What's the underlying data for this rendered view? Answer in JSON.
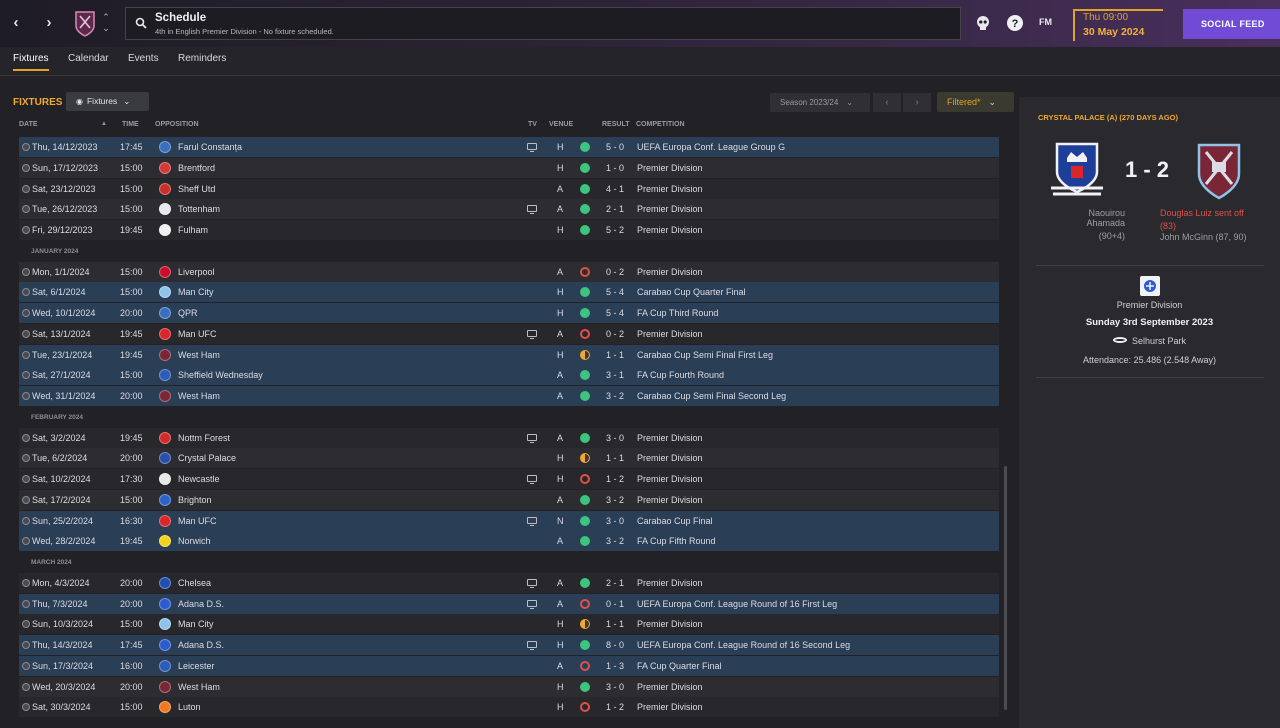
{
  "topbar": {
    "title": "Schedule",
    "subtitle": "4th in English Premier Division - No fixture scheduled.",
    "fm_label": "FM",
    "date_time": "Thu 09:00",
    "date_day": "30 May 2024",
    "social_feed_label": "SOCIAL FEED"
  },
  "tabs": [
    {
      "label": "Fixtures",
      "active": true
    },
    {
      "label": "Calendar",
      "active": false
    },
    {
      "label": "Events",
      "active": false
    },
    {
      "label": "Reminders",
      "active": false
    }
  ],
  "fixtures": {
    "title": "FIXTURES",
    "view_dropdown": "Fixtures",
    "season_dropdown": "Season 2023/24",
    "filter_label": "Filtered*",
    "columns": {
      "date": "DATE",
      "time": "TIME",
      "opposition": "OPPOSITION",
      "tv": "TV",
      "venue": "VENUE",
      "result": "RESULT",
      "competition": "COMPETITION"
    },
    "months": [
      "JANUARY 2024",
      "FEBRUARY 2024",
      "MARCH 2024"
    ],
    "rows": [
      {
        "date": "Thu, 14/12/2023",
        "time": "17:45",
        "opp": "Farul Constanța",
        "tv": true,
        "venue": "H",
        "outcome": "W",
        "result": "5 - 0",
        "comp": "UEFA Europa Conf. League Group G",
        "hl": true,
        "badge": "#3a6fc0"
      },
      {
        "date": "Sun, 17/12/2023",
        "time": "15:00",
        "opp": "Brentford",
        "tv": false,
        "venue": "H",
        "outcome": "W",
        "result": "1 - 0",
        "comp": "Premier Division",
        "hl": false,
        "badge": "#d23a3a"
      },
      {
        "date": "Sat, 23/12/2023",
        "time": "15:00",
        "opp": "Sheff Utd",
        "tv": false,
        "venue": "A",
        "outcome": "W",
        "result": "4 - 1",
        "comp": "Premier Division",
        "hl": false,
        "badge": "#c8302c"
      },
      {
        "date": "Tue, 26/12/2023",
        "time": "15:00",
        "opp": "Tottenham",
        "tv": true,
        "venue": "A",
        "outcome": "W",
        "result": "2 - 1",
        "comp": "Premier Division",
        "hl": false,
        "badge": "#e8e8f0"
      },
      {
        "date": "Fri, 29/12/2023",
        "time": "19:45",
        "opp": "Fulham",
        "tv": false,
        "venue": "H",
        "outcome": "W",
        "result": "5 - 2",
        "comp": "Premier Division",
        "hl": false,
        "badge": "#f0f0f0"
      },
      {
        "month": 0
      },
      {
        "date": "Mon, 1/1/2024",
        "time": "15:00",
        "opp": "Liverpool",
        "tv": false,
        "venue": "A",
        "outcome": "L",
        "result": "0 - 2",
        "comp": "Premier Division",
        "hl": false,
        "badge": "#c8102e"
      },
      {
        "date": "Sat, 6/1/2024",
        "time": "15:00",
        "opp": "Man City",
        "tv": false,
        "venue": "H",
        "outcome": "W",
        "result": "5 - 4",
        "comp": "Carabao Cup Quarter Final",
        "hl": true,
        "badge": "#8fc3ea"
      },
      {
        "date": "Wed, 10/1/2024",
        "time": "20:00",
        "opp": "QPR",
        "tv": false,
        "venue": "H",
        "outcome": "W",
        "result": "5 - 4",
        "comp": "FA Cup Third Round",
        "hl": true,
        "badge": "#3a6fc0"
      },
      {
        "date": "Sat, 13/1/2024",
        "time": "19:45",
        "opp": "Man UFC",
        "tv": true,
        "venue": "A",
        "outcome": "L",
        "result": "0 - 2",
        "comp": "Premier Division",
        "hl": false,
        "badge": "#d8262a"
      },
      {
        "date": "Tue, 23/1/2024",
        "time": "19:45",
        "opp": "West Ham",
        "tv": false,
        "venue": "H",
        "outcome": "D",
        "result": "1 - 1",
        "comp": "Carabao Cup Semi Final First Leg",
        "hl": true,
        "badge": "#7a2636"
      },
      {
        "date": "Sat, 27/1/2024",
        "time": "15:00",
        "opp": "Sheffield Wednesday",
        "tv": false,
        "venue": "A",
        "outcome": "W",
        "result": "3 - 1",
        "comp": "FA Cup Fourth Round",
        "hl": true,
        "badge": "#2a5cb8"
      },
      {
        "date": "Wed, 31/1/2024",
        "time": "20:00",
        "opp": "West Ham",
        "tv": false,
        "venue": "A",
        "outcome": "W",
        "result": "3 - 2",
        "comp": "Carabao Cup Semi Final Second Leg",
        "hl": true,
        "badge": "#7a2636"
      },
      {
        "month": 1
      },
      {
        "date": "Sat, 3/2/2024",
        "time": "19:45",
        "opp": "Nottm Forest",
        "tv": true,
        "venue": "A",
        "outcome": "W",
        "result": "3 - 0",
        "comp": "Premier Division",
        "hl": false,
        "badge": "#d42a2a"
      },
      {
        "date": "Tue, 6/2/2024",
        "time": "20:00",
        "opp": "Crystal Palace",
        "tv": false,
        "venue": "H",
        "outcome": "D",
        "result": "1 - 1",
        "comp": "Premier Division",
        "hl": false,
        "badge": "#2a4fa8"
      },
      {
        "date": "Sat, 10/2/2024",
        "time": "17:30",
        "opp": "Newcastle",
        "tv": true,
        "venue": "H",
        "outcome": "L",
        "result": "1 - 2",
        "comp": "Premier Division",
        "hl": false,
        "badge": "#e8e8e8"
      },
      {
        "date": "Sat, 17/2/2024",
        "time": "15:00",
        "opp": "Brighton",
        "tv": false,
        "venue": "A",
        "outcome": "W",
        "result": "3 - 2",
        "comp": "Premier Division",
        "hl": false,
        "badge": "#2a62c8"
      },
      {
        "date": "Sun, 25/2/2024",
        "time": "16:30",
        "opp": "Man UFC",
        "tv": true,
        "venue": "N",
        "outcome": "W",
        "result": "3 - 0",
        "comp": "Carabao Cup Final",
        "hl": true,
        "badge": "#d8262a"
      },
      {
        "date": "Wed, 28/2/2024",
        "time": "19:45",
        "opp": "Norwich",
        "tv": false,
        "venue": "A",
        "outcome": "W",
        "result": "3 - 2",
        "comp": "FA Cup Fifth Round",
        "hl": true,
        "badge": "#f2d21a"
      },
      {
        "month": 2
      },
      {
        "date": "Mon, 4/3/2024",
        "time": "20:00",
        "opp": "Chelsea",
        "tv": true,
        "venue": "A",
        "outcome": "W",
        "result": "2 - 1",
        "comp": "Premier Division",
        "hl": false,
        "badge": "#1f4fb0"
      },
      {
        "date": "Thu, 7/3/2024",
        "time": "20:00",
        "opp": "Adana D.S.",
        "tv": true,
        "venue": "A",
        "outcome": "L",
        "result": "0 - 1",
        "comp": "UEFA Europa Conf. League Round of 16  First Leg",
        "hl": true,
        "badge": "#2a5cd0"
      },
      {
        "date": "Sun, 10/3/2024",
        "time": "15:00",
        "opp": "Man City",
        "tv": false,
        "venue": "H",
        "outcome": "D",
        "result": "1 - 1",
        "comp": "Premier Division",
        "hl": false,
        "badge": "#8fc3ea"
      },
      {
        "date": "Thu, 14/3/2024",
        "time": "17:45",
        "opp": "Adana D.S.",
        "tv": true,
        "venue": "H",
        "outcome": "W",
        "result": "8 - 0",
        "comp": "UEFA Europa Conf. League Round of 16  Second Leg",
        "hl": true,
        "badge": "#2a5cd0"
      },
      {
        "date": "Sun, 17/3/2024",
        "time": "16:00",
        "opp": "Leicester",
        "tv": false,
        "venue": "A",
        "outcome": "L",
        "result": "1 - 3",
        "comp": "FA Cup Quarter Final",
        "hl": true,
        "badge": "#2a5cb8"
      },
      {
        "date": "Wed, 20/3/2024",
        "time": "20:00",
        "opp": "West Ham",
        "tv": false,
        "venue": "H",
        "outcome": "W",
        "result": "3 - 0",
        "comp": "Premier Division",
        "hl": false,
        "badge": "#7a2636"
      },
      {
        "date": "Sat, 30/3/2024",
        "time": "15:00",
        "opp": "Luton",
        "tv": false,
        "venue": "H",
        "outcome": "L",
        "result": "1 - 2",
        "comp": "Premier Division",
        "hl": false,
        "badge": "#f07820"
      }
    ]
  },
  "side": {
    "header": "CRYSTAL PALACE (A) (270 DAYS AGO)",
    "score": "1 - 2",
    "home_scorer_name": "Naouirou Ahamada",
    "home_scorer_min": "(90+4)",
    "away_red_name": "Douglas Luiz sent off",
    "away_red_min": "(83)",
    "away_scorer": "John McGinn (87, 90)",
    "competition": "Premier Division",
    "match_date": "Sunday 3rd September 2023",
    "stadium": "Selhurst Park",
    "attendance": "Attendance: 25.486 (2.548 Away)"
  },
  "colors": {
    "accent": "#f0a830",
    "win": "#3dc47e",
    "loss": "#e0504a",
    "highlight_row": "#2a3e56",
    "social": "#6f4bd6"
  }
}
